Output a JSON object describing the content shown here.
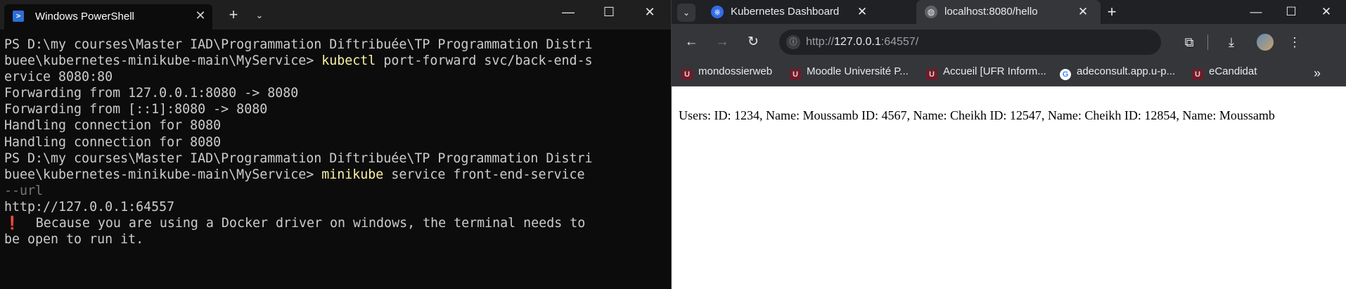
{
  "terminal": {
    "tab_title": "Windows PowerShell",
    "icon": "powershell-icon",
    "lines": [
      {
        "parts": [
          {
            "t": "PS D:\\my courses\\Master IAD\\Programmation Diftribuée\\TP Programmation Distri",
            "c": ""
          }
        ]
      },
      {
        "parts": [
          {
            "t": "buee\\kubernetes-minikube-main\\MyService> ",
            "c": ""
          },
          {
            "t": "kubectl",
            "c": "cmd"
          },
          {
            "t": " port-forward svc/back-end-s",
            "c": ""
          }
        ]
      },
      {
        "parts": [
          {
            "t": "ervice 8080:80",
            "c": ""
          }
        ]
      },
      {
        "parts": [
          {
            "t": "Forwarding from 127.0.0.1:8080 -> 8080",
            "c": ""
          }
        ]
      },
      {
        "parts": [
          {
            "t": "Forwarding from [::1]:8080 -> 8080",
            "c": ""
          }
        ]
      },
      {
        "parts": [
          {
            "t": "Handling connection for 8080",
            "c": ""
          }
        ]
      },
      {
        "parts": [
          {
            "t": "Handling connection for 8080",
            "c": ""
          }
        ]
      },
      {
        "parts": [
          {
            "t": "PS D:\\my courses\\Master IAD\\Programmation Diftribuée\\TP Programmation Distri",
            "c": ""
          }
        ]
      },
      {
        "parts": [
          {
            "t": "buee\\kubernetes-minikube-main\\MyService> ",
            "c": ""
          },
          {
            "t": "minikube",
            "c": "cmd"
          },
          {
            "t": " service front-end-service",
            "c": ""
          }
        ]
      },
      {
        "parts": [
          {
            "t": "--url",
            "c": "dim"
          }
        ]
      },
      {
        "parts": [
          {
            "t": "http://127.0.0.1:64557",
            "c": ""
          }
        ]
      },
      {
        "parts": [
          {
            "t": "❗",
            "c": "warn-icon"
          },
          {
            "t": "  Because you are using a Docker driver on windows, the terminal needs to",
            "c": ""
          }
        ]
      },
      {
        "parts": [
          {
            "t": "be open to run it.",
            "c": ""
          }
        ]
      }
    ]
  },
  "browser": {
    "tabs": [
      {
        "title": "Kubernetes Dashboard",
        "icon": "kubernetes-icon",
        "active": false
      },
      {
        "title": "localhost:8080/hello",
        "icon": "globe-icon",
        "active": true
      }
    ],
    "url": {
      "scheme": "http://",
      "host": "127.0.0.1",
      "rest": ":64557/"
    },
    "bookmarks": [
      {
        "label": "mondossierweb",
        "icon": "university-icon"
      },
      {
        "label": "Moodle Université P...",
        "icon": "university-icon"
      },
      {
        "label": "Accueil [UFR Inform...",
        "icon": "university-icon"
      },
      {
        "label": "adeconsult.app.u-p...",
        "icon": "google-icon"
      },
      {
        "label": "eCandidat",
        "icon": "university-icon"
      }
    ],
    "page_text": "Users: ID: 1234, Name: Moussamb ID: 4567, Name: Cheikh ID: 12547, Name: Cheikh ID: 12854, Name: Moussamb"
  },
  "colors": {
    "terminal_bg": "#0c0c0c",
    "command_yellow": "#f9f1a5",
    "browser_chrome": "#35363a",
    "browser_tabstrip": "#202124"
  }
}
